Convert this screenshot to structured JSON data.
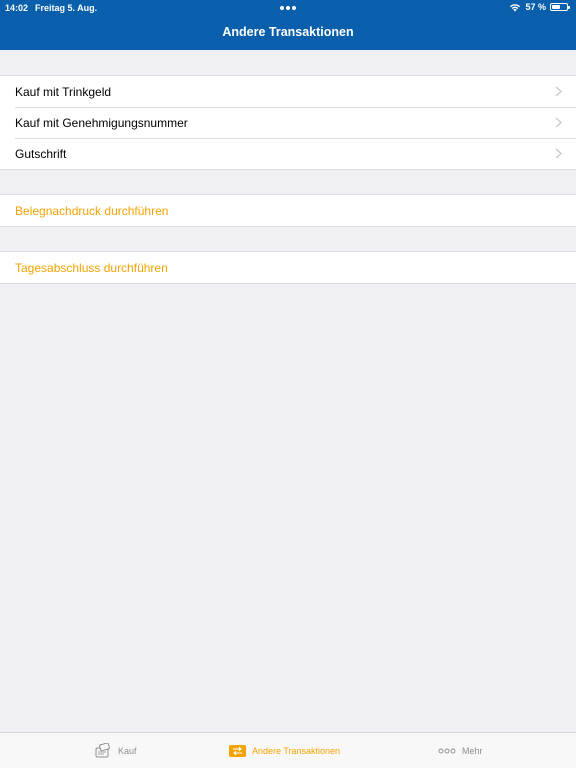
{
  "status_bar": {
    "time": "14:02",
    "date": "Freitag 5. Aug.",
    "battery_text": "57 %",
    "battery_level": 0.57
  },
  "nav": {
    "title": "Andere Transaktionen"
  },
  "groups": {
    "transactions": [
      {
        "label": "Kauf mit Trinkgeld"
      },
      {
        "label": "Kauf mit Genehmigungsnummer"
      },
      {
        "label": "Gutschrift"
      }
    ],
    "reprint": {
      "label": "Belegnachdruck durchführen"
    },
    "closing": {
      "label": "Tagesabschluss durchführen"
    }
  },
  "tabbar": {
    "items": [
      {
        "label": "Kauf",
        "icon": "card-terminal-icon",
        "active": false
      },
      {
        "label": "Andere Transaktionen",
        "icon": "transfer-icon",
        "active": true
      },
      {
        "label": "Mehr",
        "icon": "more-dots-icon",
        "active": false
      }
    ]
  },
  "colors": {
    "nav_bar": "#0a5fad",
    "accent": "#f5a300",
    "background": "#efeff4",
    "inactive_tab": "#8e8e93"
  }
}
